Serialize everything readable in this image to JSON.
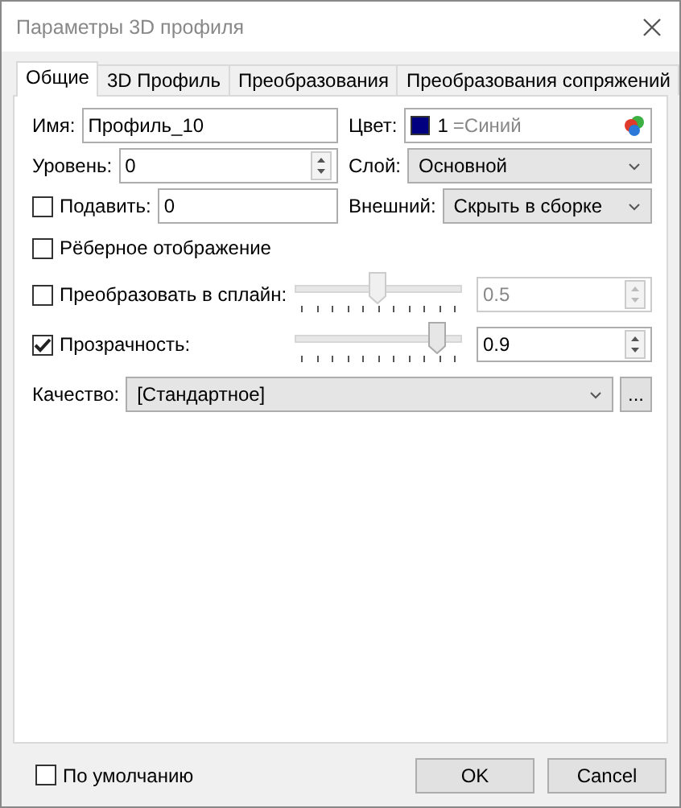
{
  "window": {
    "title": "Параметры 3D профиля"
  },
  "tabs": [
    {
      "label": "Общие",
      "selected": true
    },
    {
      "label": "3D Профиль",
      "selected": false
    },
    {
      "label": "Преобразования",
      "selected": false
    },
    {
      "label": "Преобразования сопряжений",
      "selected": false
    }
  ],
  "name": {
    "label": "Имя:",
    "value": "Профиль_10"
  },
  "color": {
    "label": "Цвет:",
    "color": "#000080",
    "index": "1",
    "name": "=Синий"
  },
  "level": {
    "label": "Уровень:",
    "value": "0"
  },
  "layer": {
    "label": "Слой:",
    "value": "Основной"
  },
  "suppress": {
    "checked": false,
    "label": "Подавить:",
    "value": "0"
  },
  "external": {
    "label": "Внешний:",
    "value": "Скрыть в сборке"
  },
  "edge_display": {
    "checked": false,
    "label": "Рёберное отображение"
  },
  "sliders": [
    {
      "checked": false,
      "disabled": true,
      "label": "Преобразовать в сплайн:",
      "level": 0.5,
      "value": "0.5"
    },
    {
      "checked": true,
      "disabled": false,
      "label": "Прозрачность:",
      "level": 0.9,
      "value": "0.9"
    }
  ],
  "quality": {
    "label": "Качество:",
    "value": "[Стандартное]",
    "button": "..."
  },
  "default": {
    "checked": false,
    "label": "По умолчанию"
  },
  "buttons": [
    "OK",
    "Cancel"
  ]
}
